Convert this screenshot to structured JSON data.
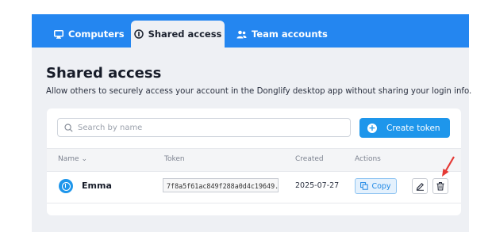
{
  "tabs": [
    {
      "label": "Computers",
      "icon": "monitor-icon"
    },
    {
      "label": "Shared access",
      "icon": "shared-access-icon"
    },
    {
      "label": "Team accounts",
      "icon": "users-icon"
    }
  ],
  "page": {
    "title": "Shared access",
    "description": "Allow others to securely access your account in the Donglify desktop app without sharing your login info."
  },
  "search": {
    "placeholder": "Search by name",
    "icon": "search-icon"
  },
  "create_button": {
    "label": "Create token",
    "icon": "plus-circle-icon"
  },
  "table": {
    "headers": {
      "name": "Name",
      "token": "Token",
      "created": "Created",
      "actions": "Actions"
    },
    "rows": [
      {
        "name": "Emma",
        "token": "7f8a5f61ac849f288a0d4c19649...",
        "created": "2025-07-27",
        "copy_label": "Copy"
      }
    ]
  },
  "colors": {
    "accent": "#2486f0",
    "button": "#1e96eb",
    "annotation": "#e53935"
  }
}
